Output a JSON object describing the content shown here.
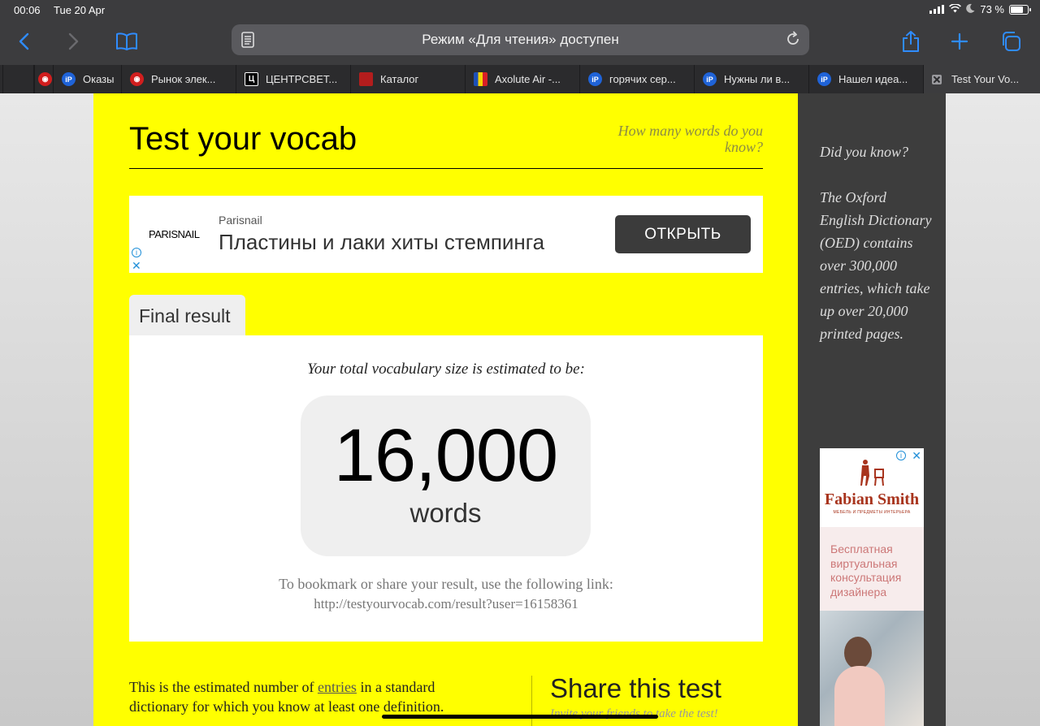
{
  "status_bar": {
    "time": "00:06",
    "date": "Tue 20 Apr",
    "battery": "73 %"
  },
  "toolbar": {
    "address_text": "Режим «Для чтения» доступен"
  },
  "tabs": [
    {
      "label": "",
      "favicon": "red-circle"
    },
    {
      "label": "Оказы",
      "favicon": "iP"
    },
    {
      "label": "Рынок элек...",
      "favicon": "red-circle"
    },
    {
      "label": "ЦЕНТРСВЕТ...",
      "favicon": "Ц"
    },
    {
      "label": "Каталог",
      "favicon": "red-square"
    },
    {
      "label": "Axolute Air -...",
      "favicon": "flag"
    },
    {
      "label": "горячих сер...",
      "favicon": "iP"
    },
    {
      "label": "Нужны ли в...",
      "favicon": "iP"
    },
    {
      "label": "Нашел идеа...",
      "favicon": "iP"
    },
    {
      "label": "Test Your Vo...",
      "favicon": "close",
      "active": true
    }
  ],
  "page": {
    "title": "Test your vocab",
    "tagline": "How many words do you know?",
    "ad": {
      "logo": "PARISNAIL",
      "brand": "Parisnail",
      "headline": "Пластины и лаки хиты стемпинга",
      "button": "ОТКРЫТЬ"
    },
    "result_tab": "Final result",
    "result_lead": "Your total vocabulary size is estimated to be:",
    "result_number": "16,000",
    "result_unit": "words",
    "share_text": "To bookmark or share your result, use the following link:",
    "share_link": "http://testyourvocab.com/result?user=16158361",
    "explanation_pre": "This is the estimated number of ",
    "explanation_link": "entries",
    "explanation_post": " in a standard dictionary for which you know at least one definition.",
    "share_title": "Share this test",
    "share_subtitle": "Invite your friends to take the test!"
  },
  "sidebar": {
    "did_you_know": "Did you know?",
    "fact": "The Oxford English Dictionary (OED) contains over 300,000 entries, which take up over 20,000 printed pages.",
    "ad": {
      "brand": "Fabian Smith",
      "sub": "МЕБЕЛЬ И ПРЕДМЕТЫ ИНТЕРЬЕРА",
      "text": "Бесплатная виртуальная консультация дизайнера"
    }
  },
  "colors": {
    "page_yellow": "#ffff00",
    "sidebar": "#3d3d3d",
    "chrome": "#3c3c3e",
    "accent_blue": "#2f8cff"
  }
}
